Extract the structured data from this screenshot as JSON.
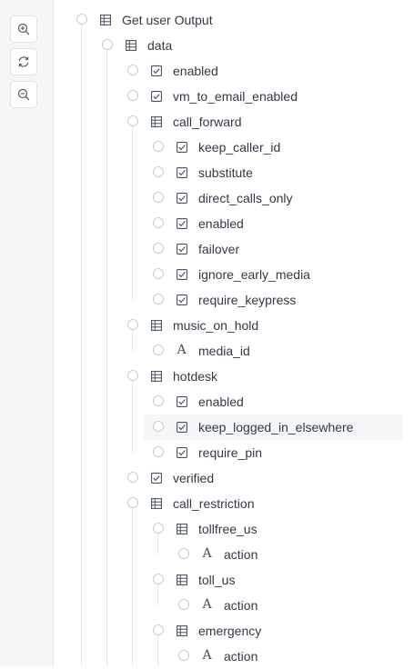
{
  "toolbar": {
    "buttons": [
      {
        "name": "zoom-in-button",
        "icon": "zoom-in-icon"
      },
      {
        "name": "reset-button",
        "icon": "refresh-icon"
      },
      {
        "name": "zoom-out-button",
        "icon": "zoom-out-icon"
      }
    ]
  },
  "tree": {
    "nodes": [
      {
        "label": "Get user Output",
        "type": "table",
        "depth": 0
      },
      {
        "label": "data",
        "type": "table",
        "depth": 1
      },
      {
        "label": "enabled",
        "type": "checkbox",
        "depth": 2
      },
      {
        "label": "vm_to_email_enabled",
        "type": "checkbox",
        "depth": 2
      },
      {
        "label": "call_forward",
        "type": "table",
        "depth": 2
      },
      {
        "label": "keep_caller_id",
        "type": "checkbox",
        "depth": 3
      },
      {
        "label": "substitute",
        "type": "checkbox",
        "depth": 3
      },
      {
        "label": "direct_calls_only",
        "type": "checkbox",
        "depth": 3
      },
      {
        "label": "enabled",
        "type": "checkbox",
        "depth": 3
      },
      {
        "label": "failover",
        "type": "checkbox",
        "depth": 3
      },
      {
        "label": "ignore_early_media",
        "type": "checkbox",
        "depth": 3
      },
      {
        "label": "require_keypress",
        "type": "checkbox",
        "depth": 3
      },
      {
        "label": "music_on_hold",
        "type": "table",
        "depth": 2
      },
      {
        "label": "media_id",
        "type": "text",
        "depth": 3
      },
      {
        "label": "hotdesk",
        "type": "table",
        "depth": 2
      },
      {
        "label": "enabled",
        "type": "checkbox",
        "depth": 3
      },
      {
        "label": "keep_logged_in_elsewhere",
        "type": "checkbox",
        "depth": 3,
        "highlighted": true
      },
      {
        "label": "require_pin",
        "type": "checkbox",
        "depth": 3
      },
      {
        "label": "verified",
        "type": "checkbox",
        "depth": 2
      },
      {
        "label": "call_restriction",
        "type": "table",
        "depth": 2
      },
      {
        "label": "tollfree_us",
        "type": "table",
        "depth": 3
      },
      {
        "label": "action",
        "type": "text",
        "depth": 4
      },
      {
        "label": "toll_us",
        "type": "table",
        "depth": 3
      },
      {
        "label": "action",
        "type": "text",
        "depth": 4
      },
      {
        "label": "emergency",
        "type": "table",
        "depth": 3
      },
      {
        "label": "action",
        "type": "text",
        "depth": 4
      }
    ]
  },
  "icons": {
    "table": "table-icon",
    "checkbox": "checkbox-icon",
    "text": "text-type-icon"
  },
  "colors": {
    "highlight": "#f5f6f8",
    "border": "#c9cdd3",
    "text": "#333a44"
  }
}
